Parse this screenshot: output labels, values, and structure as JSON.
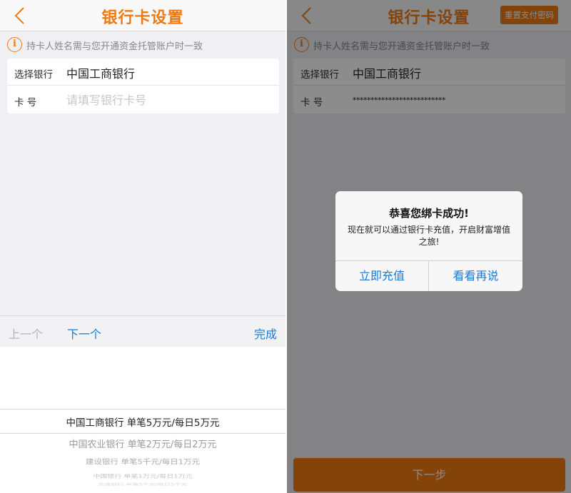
{
  "colors": {
    "accent": "#ee7a12",
    "link_blue": "#1a7bd6",
    "placeholder_gray": "#c7c7cc"
  },
  "icons": {
    "back": "chevron-left-icon",
    "info": "info-circle-icon"
  },
  "left": {
    "nav_title": "银行卡设置",
    "notice": {
      "icon_glyph": "i",
      "text": "持卡人姓名需与您开通资金托管账户时一致"
    },
    "form": {
      "bank_label": "选择银行",
      "bank_value": "中国工商银行",
      "card_label": "卡  号",
      "card_placeholder": "请填写银行卡号",
      "card_value": ""
    },
    "toolbar": {
      "prev": "上一个",
      "next": "下一个",
      "done": "完成"
    },
    "picker": {
      "options": [
        "中国工商银行 单笔5万元/每日5万元",
        "中国农业银行 单笔2万元/每日2万元",
        "建设银行 单笔5千元/每日1万元",
        "中国银行 单笔1万元/每日1万元",
        "交通银行 单笔5千元/每日5千元"
      ],
      "selected_index": 0
    }
  },
  "right": {
    "nav_title": "银行卡设置",
    "reset_button": "重置支付密码",
    "notice": {
      "icon_glyph": "i",
      "text": "持卡人姓名需与您开通资金托管账户时一致"
    },
    "form": {
      "bank_label": "选择银行",
      "bank_value": "中国工商银行",
      "card_label": "卡  号",
      "card_masked": "**************************"
    },
    "next_step_button": "下一步",
    "alert": {
      "title": "恭喜您绑卡成功!",
      "message": "现在就可以通过银行卡充值，开启财富增值之旅!",
      "buttons": [
        "立即充值",
        "看看再说"
      ]
    }
  }
}
